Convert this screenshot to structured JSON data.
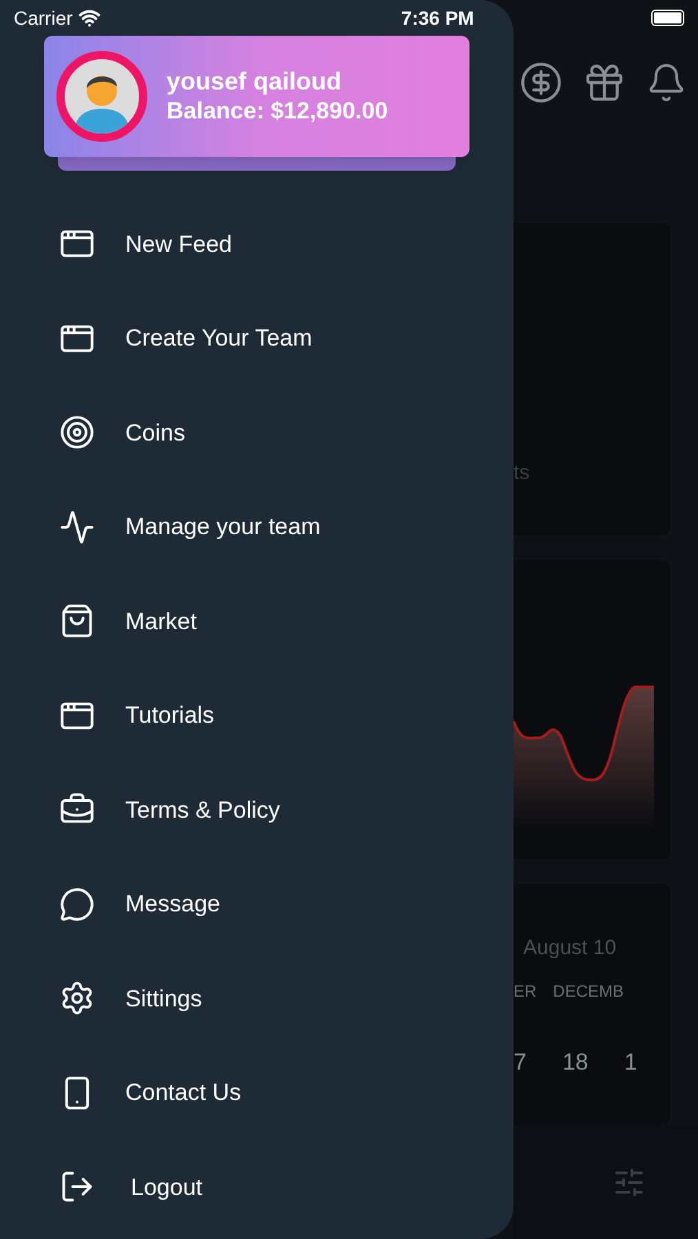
{
  "status_bar": {
    "carrier": "Carrier",
    "time": "7:36 PM"
  },
  "profile": {
    "name": "yousef qailoud",
    "balance": "Balance: $12,890.00"
  },
  "menu": [
    {
      "label": "New Feed"
    },
    {
      "label": "Create Your Team"
    },
    {
      "label": "Coins"
    },
    {
      "label": "Manage your team"
    },
    {
      "label": "Market"
    },
    {
      "label": "Tutorials"
    },
    {
      "label": "Terms & Policy"
    },
    {
      "label": "Message"
    },
    {
      "label": "Sittings"
    },
    {
      "label": "Contact Us"
    },
    {
      "label": "Logout"
    }
  ],
  "background": {
    "card_text": "ts",
    "date": "August 10",
    "months": [
      "ER",
      "DECEMB"
    ],
    "days": [
      "7",
      "18",
      "1"
    ]
  }
}
